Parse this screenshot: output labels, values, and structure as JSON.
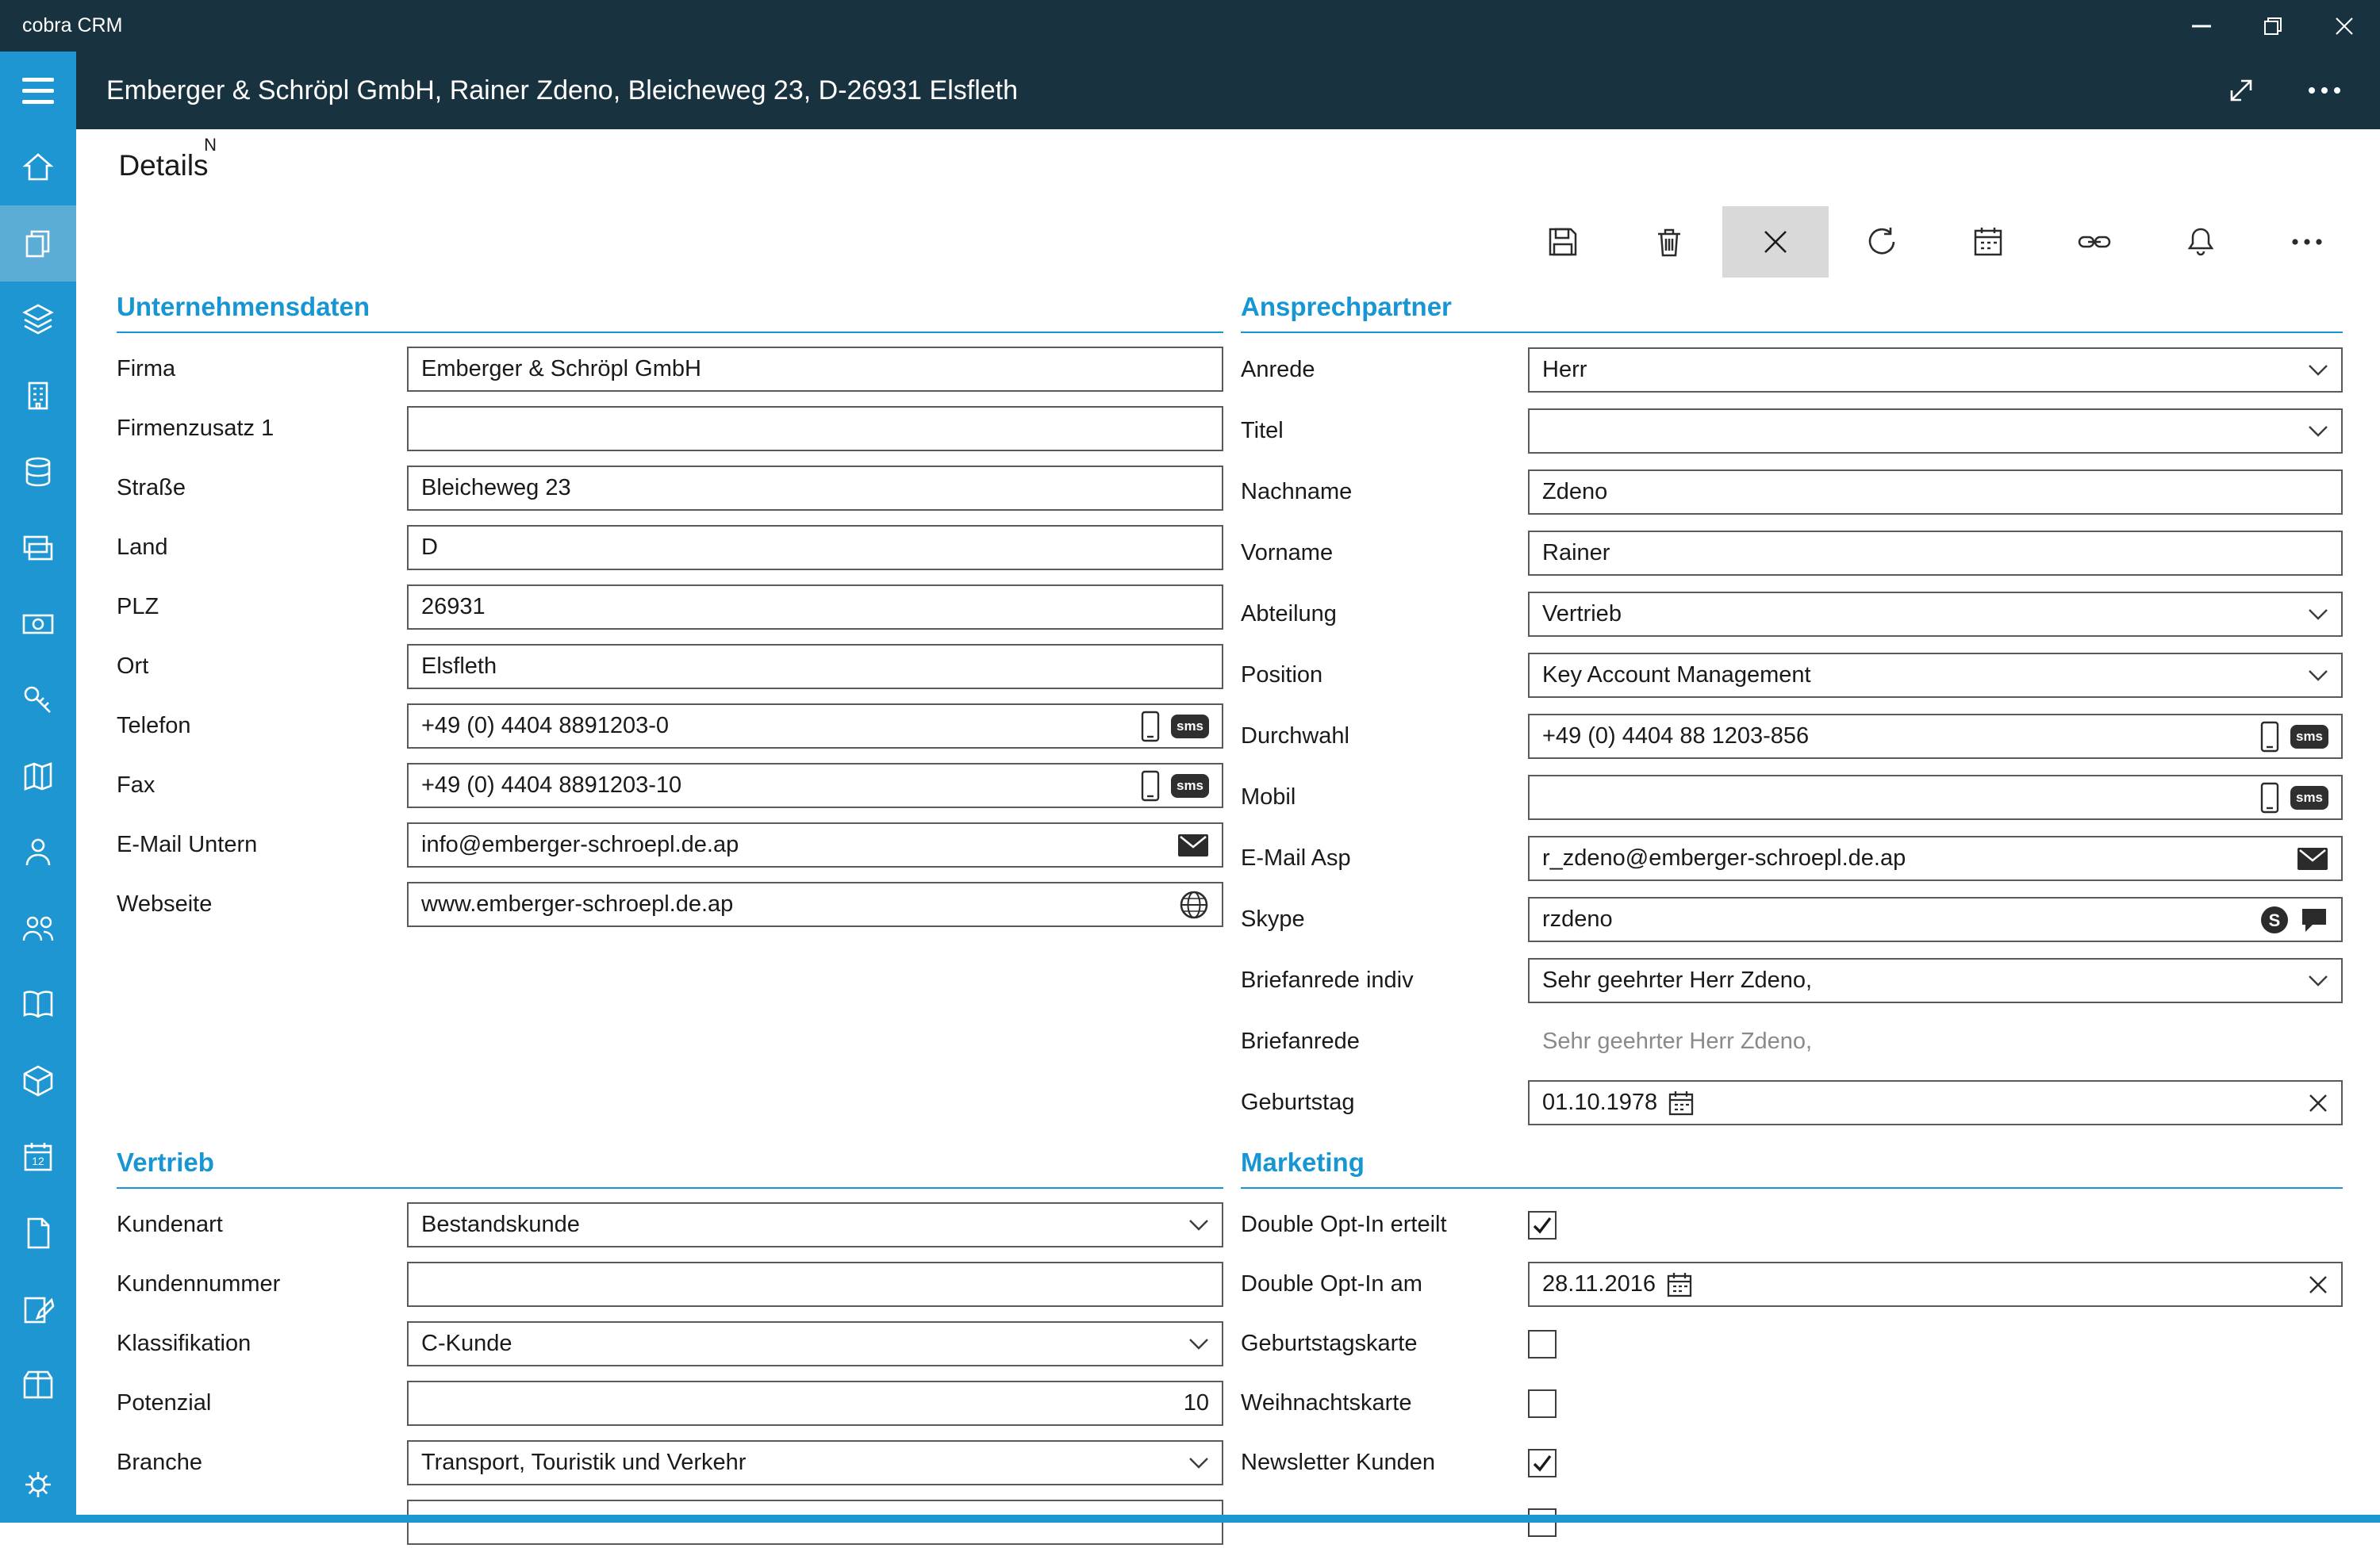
{
  "titlebar": {
    "app_name": "cobra CRM"
  },
  "window_controls": {
    "minimize": "minimize",
    "restore": "restore",
    "close": "close"
  },
  "header": {
    "title": "Emberger & Schröpl GmbH, Rainer Zdeno, Bleicheweg 23, D-26931 Elsfleth"
  },
  "tab": {
    "label": "Details",
    "badge": "N"
  },
  "colors": {
    "titlebar": "#18333f",
    "sidebar": "#1e96d2",
    "sidebar_selected": "#5badd8",
    "accent": "#1796d3",
    "toolbar_active_bg": "#d9d9d9"
  },
  "toolbar": {
    "icons": [
      "save",
      "delete",
      "close",
      "refresh",
      "calendar",
      "link",
      "notifications",
      "more"
    ]
  },
  "sms_label": "sms",
  "sidebar_calendar_day": "12",
  "sections": {
    "unternehmensdaten": {
      "title": "Unternehmensdaten",
      "fields": [
        {
          "label": "Firma",
          "value": "Emberger & Schröpl GmbH"
        },
        {
          "label": "Firmenzusatz 1",
          "value": ""
        },
        {
          "label": "Straße",
          "value": "Bleicheweg 23"
        },
        {
          "label": "Land",
          "value": "D"
        },
        {
          "label": "PLZ",
          "value": "26931"
        },
        {
          "label": "Ort",
          "value": "Elsfleth"
        },
        {
          "label": "Telefon",
          "value": "+49 (0) 4404 8891203-0"
        },
        {
          "label": "Fax",
          "value": "+49 (0) 4404 8891203-10"
        },
        {
          "label": "E-Mail Untern",
          "value": "info@emberger-schroepl.de.ap"
        },
        {
          "label": "Webseite",
          "value": "www.emberger-schroepl.de.ap"
        }
      ]
    },
    "ansprechpartner": {
      "title": "Ansprechpartner",
      "fields": [
        {
          "label": "Anrede",
          "value": "Herr"
        },
        {
          "label": "Titel",
          "value": ""
        },
        {
          "label": "Nachname",
          "value": "Zdeno"
        },
        {
          "label": "Vorname",
          "value": "Rainer"
        },
        {
          "label": "Abteilung",
          "value": "Vertrieb"
        },
        {
          "label": "Position",
          "value": "Key Account Management"
        },
        {
          "label": "Durchwahl",
          "value": "+49 (0) 4404 88 1203-856"
        },
        {
          "label": "Mobil",
          "value": ""
        },
        {
          "label": "E-Mail Asp",
          "value": "r_zdeno@emberger-schroepl.de.ap"
        },
        {
          "label": "Skype",
          "value": "rzdeno"
        },
        {
          "label": "Briefanrede indiv",
          "value": "Sehr geehrter Herr Zdeno,"
        },
        {
          "label": "Briefanrede",
          "value": "Sehr geehrter Herr Zdeno,"
        },
        {
          "label": "Geburtstag",
          "value": "01.10.1978"
        }
      ]
    },
    "vertrieb": {
      "title": "Vertrieb",
      "fields": [
        {
          "label": "Kundenart",
          "value": "Bestandskunde"
        },
        {
          "label": "Kundennummer",
          "value": ""
        },
        {
          "label": "Klassifikation",
          "value": "C-Kunde"
        },
        {
          "label": "Potenzial",
          "value": "10"
        },
        {
          "label": "Branche",
          "value": "Transport, Touristik und Verkehr"
        }
      ]
    },
    "marketing": {
      "title": "Marketing",
      "fields": [
        {
          "label": "Double Opt-In erteilt",
          "checked": true
        },
        {
          "label": "Double Opt-In am",
          "value": "28.11.2016"
        },
        {
          "label": "Geburtstagskarte",
          "checked": false
        },
        {
          "label": "Weihnachtskarte",
          "checked": false
        },
        {
          "label": "Newsletter Kunden",
          "checked": true
        }
      ]
    }
  }
}
